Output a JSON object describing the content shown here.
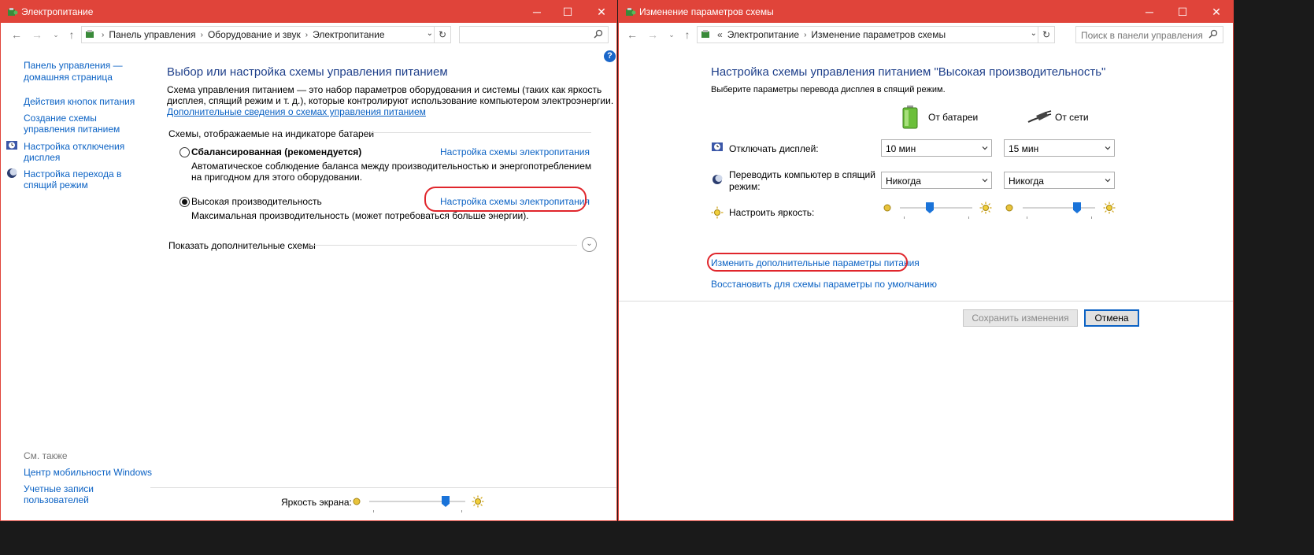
{
  "left": {
    "title": "Электропитание",
    "breadcrumb": [
      "Панель управления",
      "Оборудование и звук",
      "Электропитание"
    ],
    "search_placeholder": "",
    "sidebar": {
      "home": "Панель управления — домашняя страница",
      "items": [
        "Действия кнопок питания",
        "Создание схемы управления питанием",
        "Настройка отключения дисплея",
        "Настройка перехода в спящий режим"
      ],
      "see_also_label": "См. также",
      "see_also": [
        "Центр мобильности Windows",
        "Учетные записи пользователей"
      ]
    },
    "main": {
      "heading": "Выбор или настройка схемы управления питанием",
      "desc_line1": "Схема управления питанием — это набор параметров оборудования и системы (таких как яркость",
      "desc_line2": "дисплея, спящий режим и т. д.), которые контролируют использование компьютером электроэнергии.",
      "more_link": "Дополнительные сведения о схемах управления питанием",
      "section_label": "Схемы, отображаемые на индикаторе батареи",
      "plans": [
        {
          "name": "Сбалансированная (рекомендуется)",
          "selected": false,
          "desc_line1": "Автоматическое соблюдение баланса между производительностью и энергопотреблением",
          "desc_line2": "на пригодном для этого оборудовании.",
          "settings_link": "Настройка схемы электропитания"
        },
        {
          "name": "Высокая производительность",
          "selected": true,
          "desc_line1": "Максимальная производительность (может потребоваться больше энергии).",
          "desc_line2": "",
          "settings_link": "Настройка схемы электропитания"
        }
      ],
      "show_more": "Показать дополнительные схемы"
    },
    "footer": {
      "brightness_label": "Яркость экрана:",
      "brightness_value": 0.82
    }
  },
  "right": {
    "title": "Изменение параметров схемы",
    "breadcrumb_prefix": "«",
    "breadcrumb": [
      "Электропитание",
      "Изменение параметров схемы"
    ],
    "search_placeholder": "Поиск в панели управления",
    "heading": "Настройка схемы управления питанием \"Высокая производительность\"",
    "subtitle": "Выберите параметры перевода дисплея в спящий режим.",
    "col_battery": "От батареи",
    "col_ac": "От сети",
    "rows": {
      "display_label": "Отключать дисплей:",
      "display_battery": "10 мин",
      "display_ac": "15 мин",
      "sleep_label_line1": "Переводить компьютер в спящий",
      "sleep_label_line2": "режим:",
      "sleep_battery": "Никогда",
      "sleep_ac": "Никогда",
      "brightness_label": "Настроить яркость:",
      "brightness_battery": 0.4,
      "brightness_ac": 0.78
    },
    "advanced_link": "Изменить дополнительные параметры питания",
    "restore_link": "Восстановить для схемы параметры по умолчанию",
    "save_button": "Сохранить изменения",
    "cancel_button": "Отмена"
  },
  "colors": {
    "titlebar": "#e0443a",
    "link": "#0b62c4",
    "heading": "#1e3f8a",
    "highlight_oval": "#e0262c"
  }
}
